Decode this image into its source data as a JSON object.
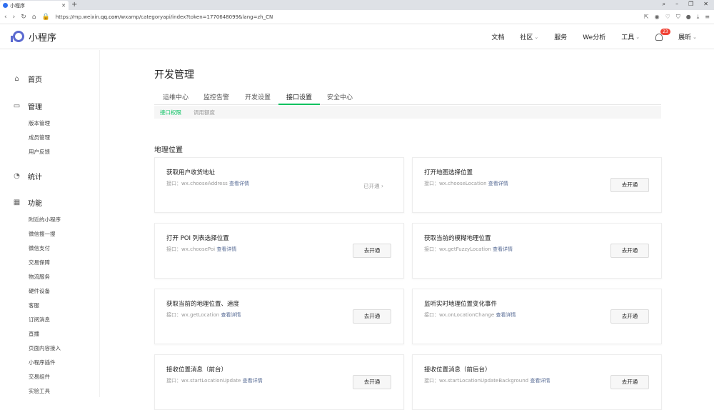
{
  "browser": {
    "tab_title": "小程序",
    "new_tab": "+",
    "url_prefix": "https://mp.weixin.",
    "url_domain": "qq.com",
    "url_suffix": "/wxamp/categoryapi/index?token=1770648099&lang=zh_CN"
  },
  "header": {
    "logo_text": "小程序",
    "menu": [
      {
        "label": "文档"
      },
      {
        "label": "社区"
      },
      {
        "label": "服务"
      },
      {
        "label": "We分析"
      },
      {
        "label": "工具"
      }
    ],
    "notification_count": "23",
    "user_name": "展昕"
  },
  "sidebar": {
    "sections": [
      {
        "label": "首页",
        "icon": "home-icon",
        "items": []
      },
      {
        "label": "管理",
        "icon": "inbox-icon",
        "items": [
          "版本管理",
          "成员管理",
          "用户反馈"
        ]
      },
      {
        "label": "统计",
        "icon": "pie-chart-icon",
        "items": []
      },
      {
        "label": "功能",
        "icon": "grid-icon",
        "items": [
          "附近的小程序",
          "微信搜一搜",
          "微信支付",
          "交易保障",
          "物流服务",
          "硬件设备",
          "客服",
          "订阅消息",
          "直播",
          "页面内容接入",
          "小程序插件",
          "交易组件",
          "实验工具"
        ]
      }
    ]
  },
  "main": {
    "title": "开发管理",
    "tabs": [
      "运维中心",
      "监控告警",
      "开发设置",
      "接口设置",
      "安全中心"
    ],
    "active_tab": "接口设置",
    "subtabs": [
      "接口权限",
      "调用额度"
    ],
    "section_title": "地理位置",
    "cards": [
      {
        "title": "获取用户收货地址",
        "prefix": "接口：",
        "api": "wx.chooseAddress",
        "link": "查看详情",
        "action": "已开通",
        "opened": true
      },
      {
        "title": "打开地图选择位置",
        "prefix": "接口：",
        "api": "wx.chooseLocation",
        "link": "查看详情",
        "action": "去开通",
        "opened": false
      },
      {
        "title": "打开 POI 列表选择位置",
        "prefix": "接口：",
        "api": "wx.choosePoi",
        "link": "查看详情",
        "action": "去开通",
        "opened": false
      },
      {
        "title": "获取当前的模糊地理位置",
        "prefix": "接口：",
        "api": "wx.getFuzzyLocation",
        "link": "查看详情",
        "action": "去开通",
        "opened": false
      },
      {
        "title": "获取当前的地理位置、速度",
        "prefix": "接口：",
        "api": "wx.getLocation",
        "link": "查看详情",
        "action": "去开通",
        "opened": false
      },
      {
        "title": "监听实时地理位置变化事件",
        "prefix": "接口：",
        "api": "wx.onLocationChange",
        "link": "查看详情",
        "action": "去开通",
        "opened": false
      },
      {
        "title": "接收位置消息（前台）",
        "prefix": "接口：",
        "api": "wx.startLocationUpdate",
        "link": "查看详情",
        "action": "去开通",
        "opened": false
      },
      {
        "title": "接收位置消息（前后台）",
        "prefix": "接口：",
        "api": "wx.startLocationUpdateBackground",
        "link": "查看详情",
        "action": "去开通",
        "opened": false
      }
    ]
  },
  "colors": {
    "accent": "#07c160",
    "link": "#576b95",
    "badge": "#f04134"
  }
}
